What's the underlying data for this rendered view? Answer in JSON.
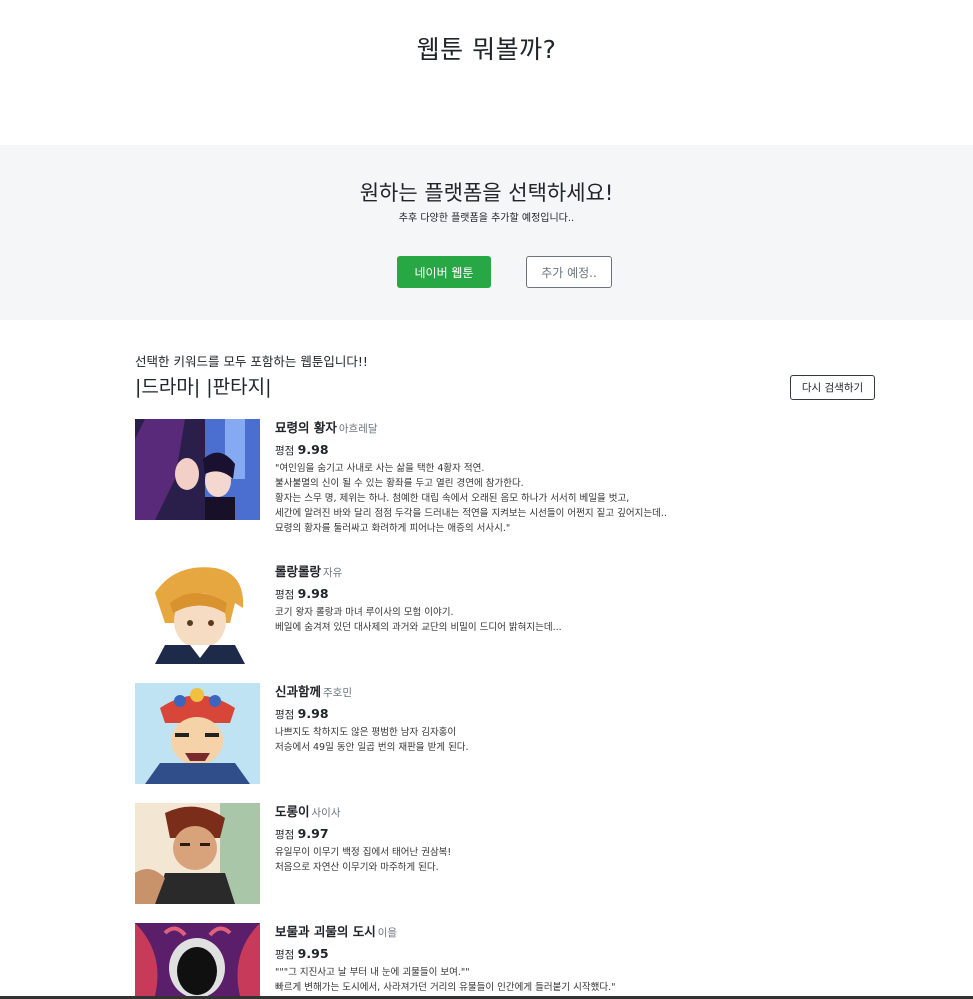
{
  "header": {
    "title": "웹툰 뭐볼까?"
  },
  "platform": {
    "heading": "원하는 플랫폼을 선택하세요!",
    "subtext": "추후 다양한 플랫폼을 추가할 예정입니다..",
    "naver_button": "네이버 웹툰",
    "more_button": "추가 예정..",
    "panel_color": "#f4f6f8",
    "accent_color": "#28a745"
  },
  "results": {
    "intro": "선택한 키워드를 모두 포함하는 웹툰입니다!!",
    "keywords": "|드라마| |판타지|",
    "research_button": "다시 검색하기",
    "rating_label": "평점",
    "items": [
      {
        "title": "묘령의 황자",
        "author": "아흐레달",
        "rating": "9.98",
        "thumbnail_icon": "webtoon-thumbnail-purple",
        "desc": [
          "\"여인임을 숨기고 사내로 사는 삶을 택한 4황자 적연.",
          "불사불멸의 신이 될 수 있는 황좌를 두고 열린 경연에 참가한다.",
          "황자는 스무 명, 제위는 하나. 첨예한 대립 속에서 오래된 음모 하나가 서서히 베일을 벗고,",
          "세간에 알려진 바와 달리 점점 두각을 드러내는 적연을 지켜보는 시선들이 어쩐지 짙고 깊어지는데..",
          "묘령의 황자를 둘러싸고 화려하게 피어나는 애증의 서사시.\""
        ]
      },
      {
        "title": "롤랑롤랑",
        "author": "자유",
        "rating": "9.98",
        "thumbnail_icon": "webtoon-thumbnail-blond",
        "desc": [
          "코기 왕자 롤랑과 마녀 루이사의 모험 이야기.",
          "베일에 숨겨져 있던 대사제의 과거와 교단의 비밀이 드디어 밝혀지는데..."
        ]
      },
      {
        "title": "신과함께",
        "author": "주호민",
        "rating": "9.98",
        "thumbnail_icon": "webtoon-thumbnail-warrior",
        "desc": [
          "나쁘지도 착하지도 않은 평범한 남자 김자홍이",
          "저승에서 49일 동안 일곱 번의 재판을 받게 된다."
        ]
      },
      {
        "title": "도롱이",
        "author": "사이사",
        "rating": "9.97",
        "thumbnail_icon": "webtoon-thumbnail-fighter",
        "desc": [
          "유일무이 이무기 백정 집에서 태어난 권삼복!",
          "처음으로 자연산 이무기와 마주하게 된다."
        ]
      },
      {
        "title": "보물과 괴물의 도시",
        "author": "이을",
        "rating": "9.95",
        "thumbnail_icon": "webtoon-thumbnail-monster",
        "desc": [
          "\"\"\"그 지진사고 날 부터 내 눈에 괴물들이 보여.\"\"",
          "빠르게 변해가는 도시에서, 사라져가던 거리의 유물들이 인간에게 들러붙기 시작했다.\""
        ]
      }
    ]
  }
}
